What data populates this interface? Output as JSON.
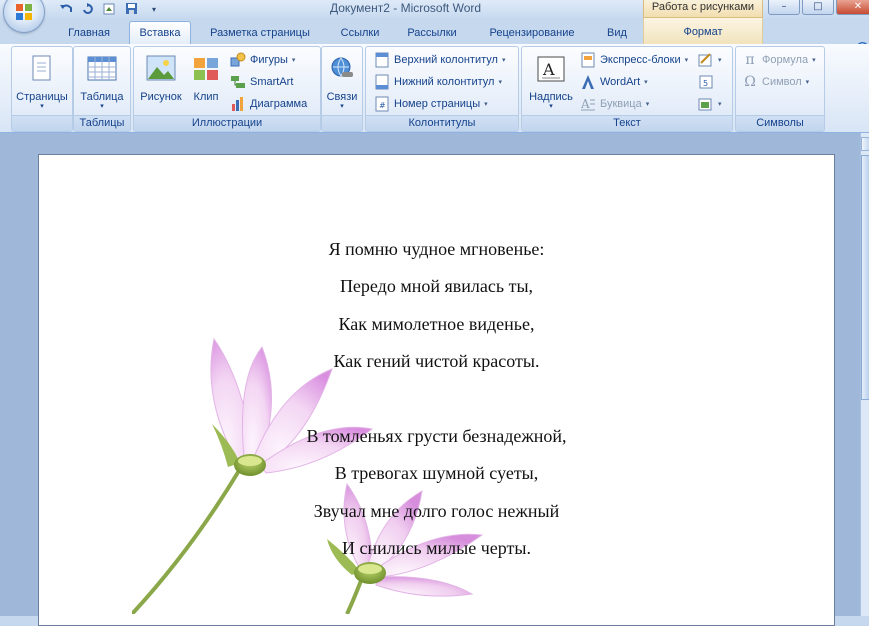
{
  "window": {
    "title": "Документ2 - Microsoft Word",
    "context_tab_group": "Работа с рисунками",
    "controls": [
      "–",
      "□",
      "✕"
    ]
  },
  "quick_access": [
    "save-icon",
    "undo-icon",
    "redo-icon",
    "customize-icon"
  ],
  "tabs": [
    {
      "label": "Главная"
    },
    {
      "label": "Вставка",
      "active": true
    },
    {
      "label": "Разметка страницы"
    },
    {
      "label": "Ссылки"
    },
    {
      "label": "Рассылки"
    },
    {
      "label": "Рецензирование"
    },
    {
      "label": "Вид"
    },
    {
      "label": "Формат",
      "context": true
    }
  ],
  "help_label": "?",
  "ribbon": {
    "groups": [
      {
        "label": "",
        "buttons": [
          {
            "label": "Страницы",
            "icon": "pages-icon"
          }
        ]
      },
      {
        "label": "Таблицы",
        "buttons": [
          {
            "label": "Таблица",
            "icon": "table-icon"
          }
        ]
      },
      {
        "label": "Иллюстрации",
        "buttons": [
          {
            "label": "Рисунок",
            "icon": "picture-icon"
          },
          {
            "label": "Клип",
            "icon": "clipart-icon"
          },
          {
            "label": "Фигуры",
            "icon": "shapes-icon"
          },
          {
            "label": "SmartArt",
            "icon": "smartart-icon"
          },
          {
            "label": "Диаграмма",
            "icon": "chart-icon"
          }
        ]
      },
      {
        "label": "",
        "buttons": [
          {
            "label": "Связи",
            "icon": "links-icon"
          }
        ]
      },
      {
        "label": "Колонтитулы",
        "buttons": [
          {
            "label": "Верхний колонтитул",
            "icon": "header-icon"
          },
          {
            "label": "Нижний колонтитул",
            "icon": "footer-icon"
          },
          {
            "label": "Номер страницы",
            "icon": "page-number-icon"
          }
        ]
      },
      {
        "label": "Текст",
        "buttons": [
          {
            "label": "Надпись",
            "icon": "textbox-icon"
          },
          {
            "label": "Экспресс-блоки",
            "icon": "quickparts-icon"
          },
          {
            "label": "WordArt",
            "icon": "wordart-icon"
          },
          {
            "label": "Буквица",
            "icon": "dropcap-icon",
            "disabled": true
          }
        ]
      },
      {
        "label": "Символы",
        "buttons": [
          {
            "label": "Формула",
            "icon": "equation-icon",
            "disabled": true
          },
          {
            "label": "Символ",
            "icon": "symbol-icon",
            "disabled": true
          }
        ]
      }
    ]
  },
  "document": {
    "poem": [
      "Я помню чудное мгновенье:",
      "Передо мной явилась ты,",
      "Как мимолетное виденье,",
      "Как гений чистой красоты.",
      "",
      "В томленьях грусти безнадежной,",
      "В тревогах шумной суеты,",
      "Звучал мне долго голос нежный",
      "И снились милые черты."
    ],
    "image": "cosmos-flowers-picture"
  },
  "colors": {
    "tab_text": "#15428b",
    "ribbon_bg": "#e6eef9",
    "doc_bg": "#9fb7d8",
    "flower_petal": "#e9b8ea",
    "flower_stem": "#7a9a3a"
  }
}
